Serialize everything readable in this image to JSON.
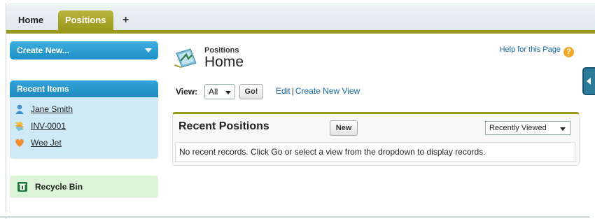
{
  "tabs": {
    "home_label": "Home",
    "positions_label": "Positions",
    "add_label": "+"
  },
  "sidebar": {
    "create_new_label": "Create New...",
    "recent_items_title": "Recent Items",
    "recent_items": [
      {
        "label": "Jane Smith",
        "icon": "contact-icon"
      },
      {
        "label": "INV-0001",
        "icon": "invoice-icon"
      },
      {
        "label": "Wee Jet",
        "icon": "merchandise-icon"
      }
    ],
    "recycle_bin_label": "Recycle Bin"
  },
  "header": {
    "object_label": "Positions",
    "title": "Home",
    "help_label": "Help for this Page",
    "help_icon_glyph": "?"
  },
  "view_bar": {
    "view_label": "View:",
    "selected_view": "All",
    "go_label": "Go!",
    "edit_label": "Edit",
    "separator": "|",
    "create_new_view_label": "Create New View"
  },
  "recent_positions": {
    "title": "Recent Positions",
    "new_label": "New",
    "filter_selected": "Recently Viewed",
    "empty_message": "No recent records. Click Go or select a view from the dropdown to display records."
  },
  "colors": {
    "accent_olive": "#9c9a1c",
    "sidebar_blue": "#1f8fc4",
    "link_blue": "#1468a7",
    "recycle_green": "#dbf3d6"
  }
}
